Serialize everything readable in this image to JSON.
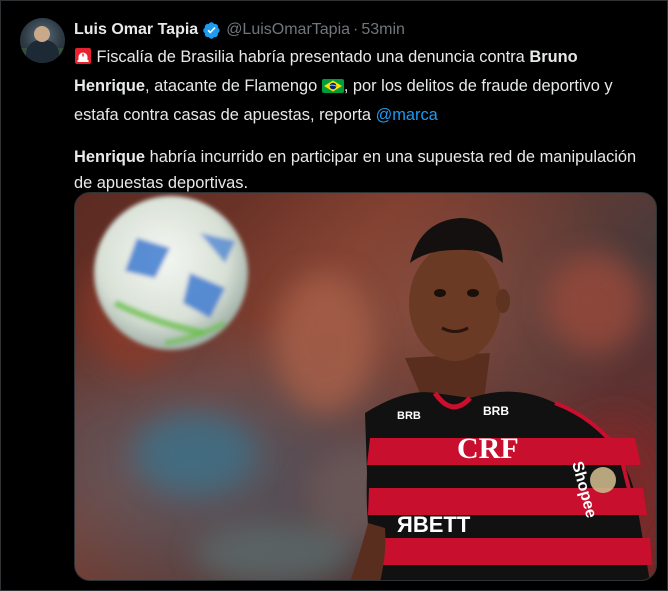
{
  "tweet": {
    "author_name": "Luis Omar Tapia",
    "handle": "@LuisOmarTapia",
    "separator": "·",
    "time": "53min",
    "p1_a": " Fiscalía de Brasilia habría presentado una denuncia contra ",
    "p1_bold": "Bruno Henrique",
    "p1_b": ", atacante de Flamengo ",
    "p1_c": ", por los delitos de fraude deportivo y estafa contra casas de apuestas, reporta ",
    "mention": "@marca",
    "p2_bold": "Henrique",
    "p2_rest": " habría incurrido en participar en una supuesta red de manipulación de apuestas deportivas."
  },
  "media": {
    "jersey_sponsor": "ЯBETT",
    "jersey_brand_left": "BRB",
    "jersey_brand_right": "BRB",
    "sleeve_sponsor": "Shopee",
    "crest": "CRF"
  },
  "colors": {
    "accent": "#1d9bf0",
    "text": "#e7e9ea",
    "muted": "#71767b",
    "background": "#000000"
  },
  "icons": [
    "siren-icon",
    "verified-badge-icon",
    "brazil-flag-icon"
  ]
}
